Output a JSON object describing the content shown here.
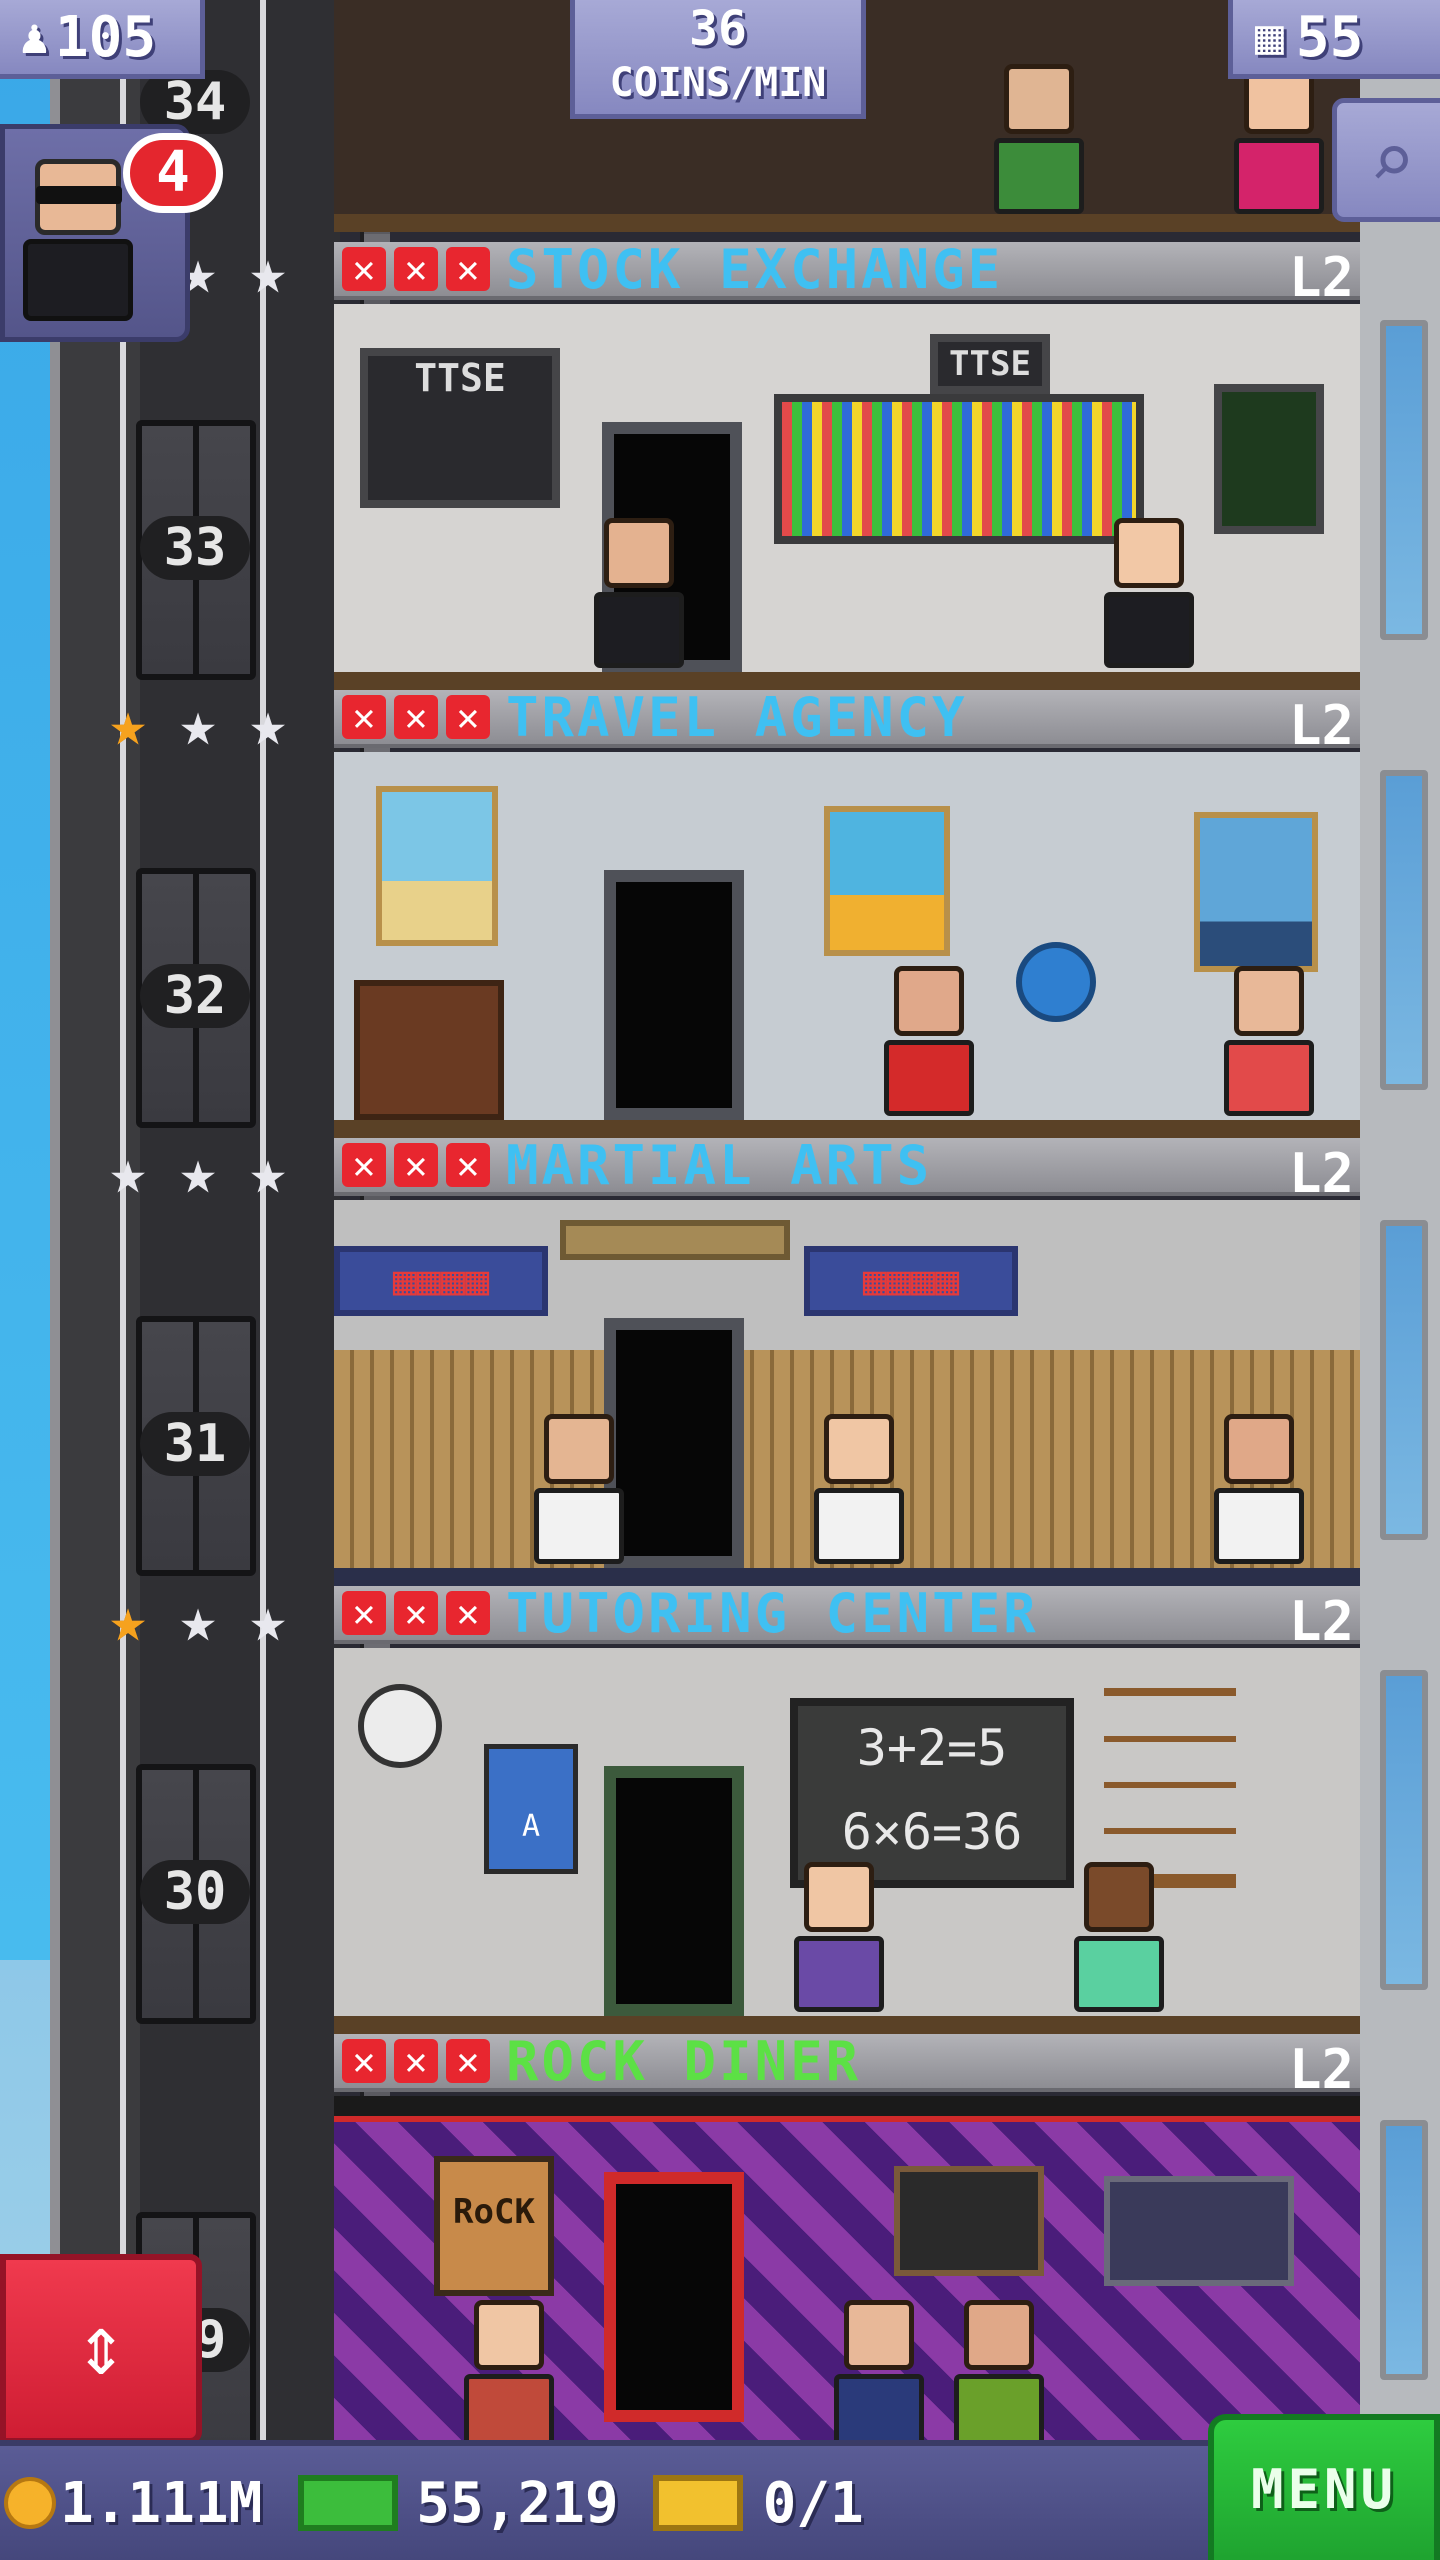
{
  "hud": {
    "population": "105",
    "coins_rate_value": "36",
    "coins_rate_unit": "COINS/MIN",
    "floor_count": "55"
  },
  "vip": {
    "badge_count": "4"
  },
  "shaft": {
    "floor_numbers": [
      "34",
      "33",
      "32",
      "31",
      "30",
      "29"
    ]
  },
  "floors": [
    {
      "name": "STOCK EXCHANGE",
      "level": "L2",
      "stars_lit": 0,
      "name_color": "#3fc0f2",
      "signs": [
        "TTSE",
        "TTSE"
      ]
    },
    {
      "name": "TRAVEL AGENCY",
      "level": "L2",
      "stars_lit": 1,
      "name_color": "#3fc0f2"
    },
    {
      "name": "MARTIAL ARTS",
      "level": "L2",
      "stars_lit": 0,
      "name_color": "#3fc0f2"
    },
    {
      "name": "TUTORING CENTER",
      "level": "L2",
      "stars_lit": 1,
      "name_color": "#3fc0f2",
      "chalkboard": [
        "3+2=5",
        "6×6=36"
      ],
      "poster_letter": "A"
    },
    {
      "name": "ROCK DINER",
      "level": "L2",
      "stars_lit": null,
      "name_color": "#5ce045",
      "sign": "RoCK"
    }
  ],
  "bottom_bar": {
    "coins": "1.111M",
    "bux": "55,219",
    "tickets": "0/1",
    "menu_label": "MENU"
  },
  "colors": {
    "accent_blue": "#3fc0f2",
    "accent_green": "#5ce045",
    "star_gold": "#f6a21e",
    "alert_red": "#e4262e"
  },
  "icons": {
    "population": "person-icon",
    "floors": "building-icon",
    "zoom": "magnifier-icon",
    "elevator": "up-down-arrows-icon",
    "coin": "coin-icon",
    "bux": "cash-icon",
    "ticket": "ticket-icon"
  }
}
